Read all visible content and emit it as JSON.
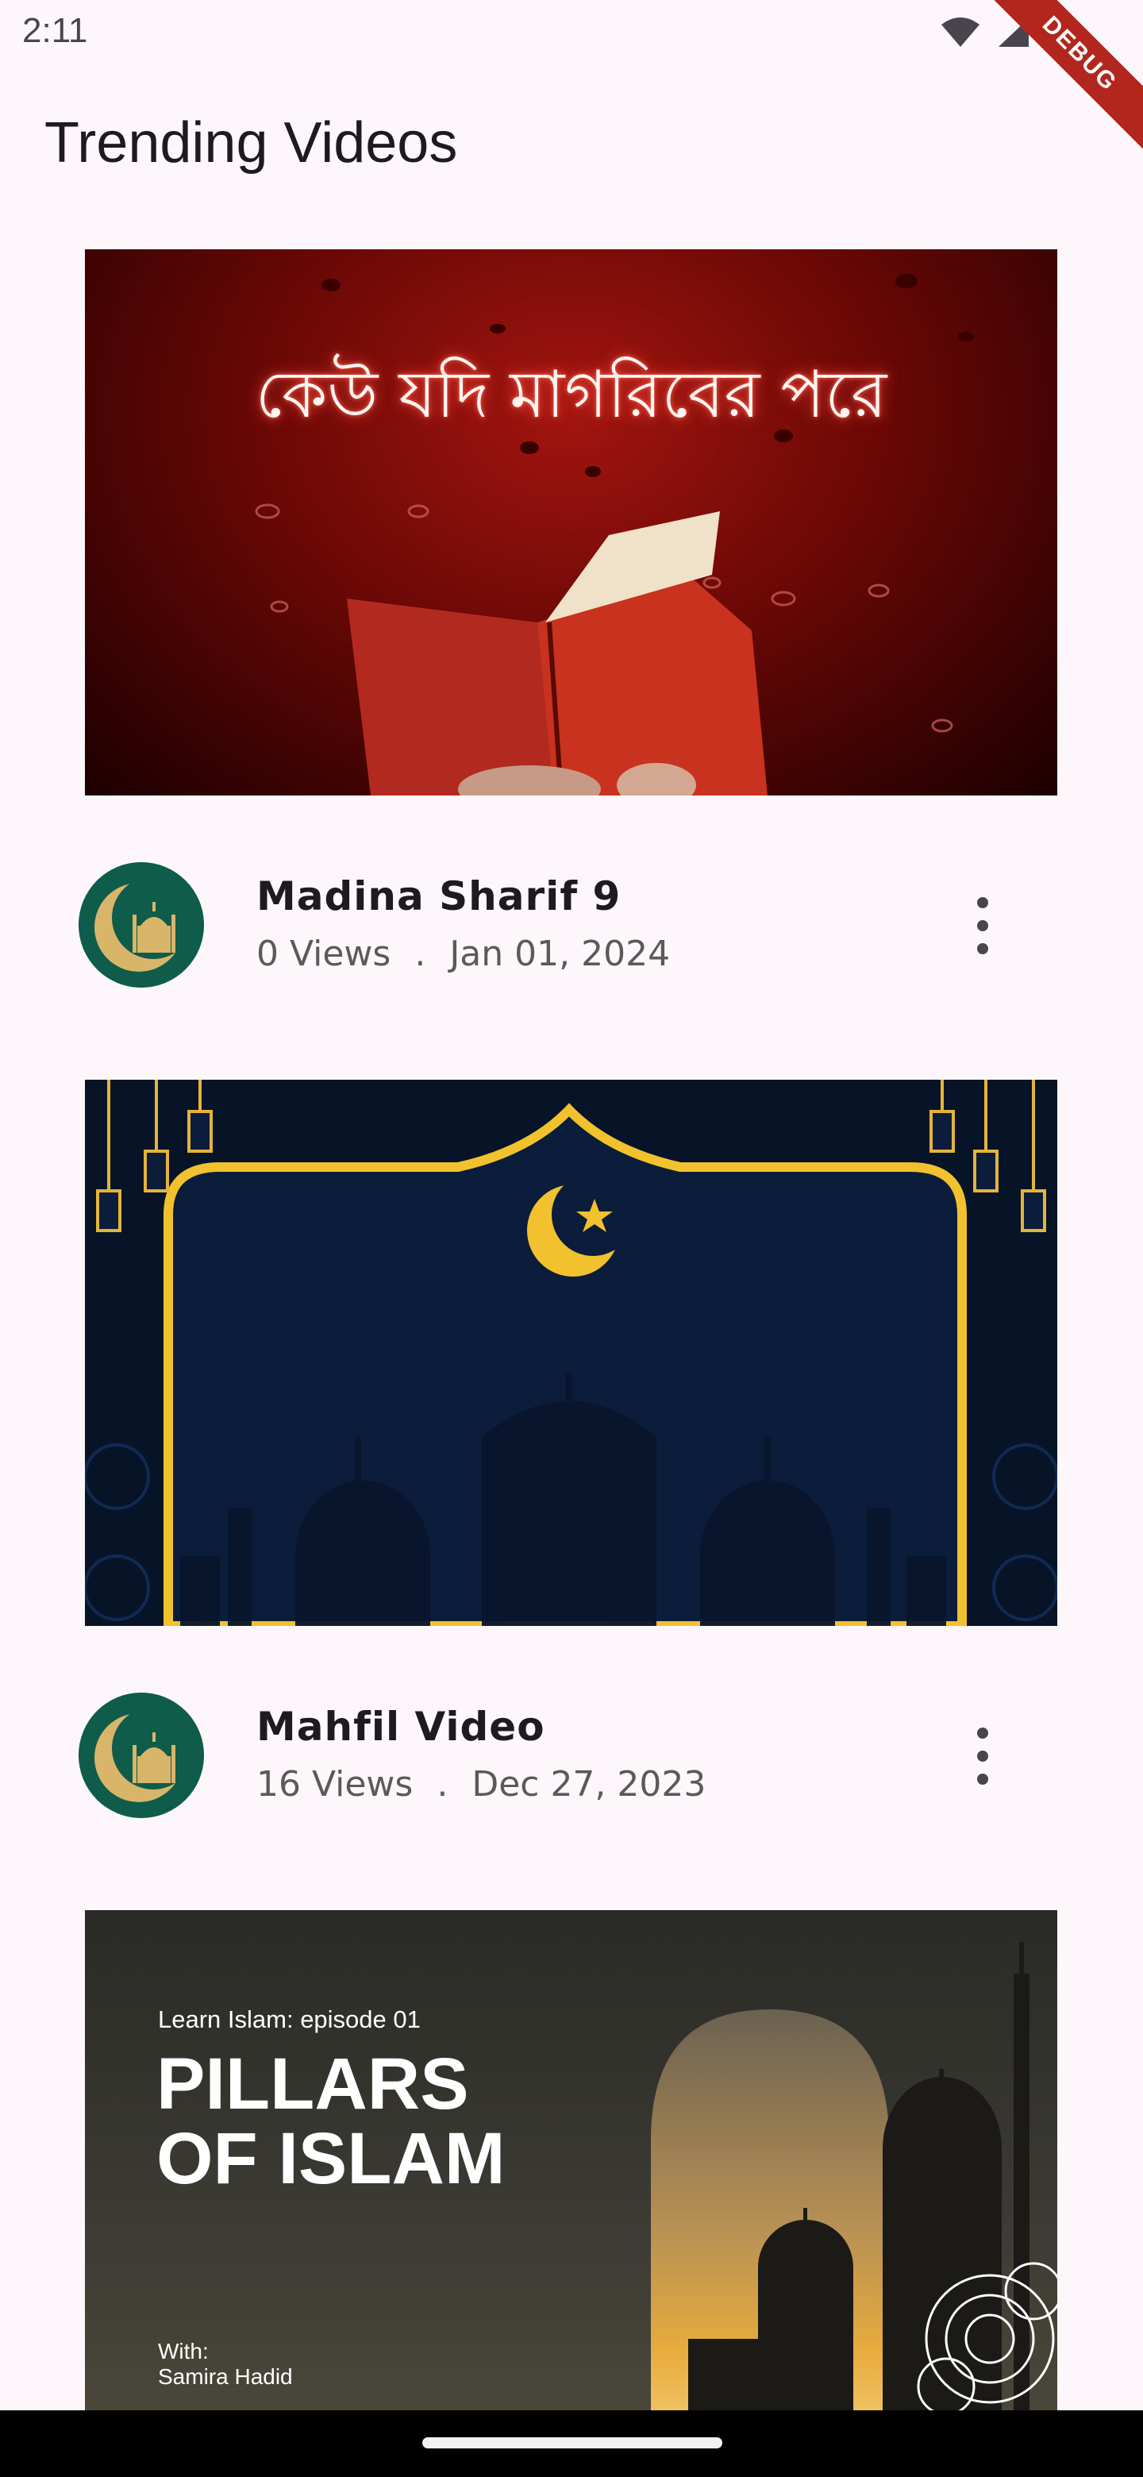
{
  "status_bar": {
    "time": "2:11",
    "debug_label": "DEBUG"
  },
  "app_bar": {
    "title": "Trending Videos"
  },
  "videos": [
    {
      "thumbnail_text": "কেউ যদি মাগরিবের পরে",
      "title": "Madina Sharif 9",
      "views": "0 Views",
      "separator": ".",
      "date": "Jan 01, 2024"
    },
    {
      "thumbnail_text": "",
      "title": "Mahfil Video",
      "views": "16 Views",
      "separator": ".",
      "date": "Dec 27, 2023"
    },
    {
      "thumbnail_kicker": "Learn Islam: episode 01",
      "thumbnail_headline_1": "PILLARS",
      "thumbnail_headline_2": "OF ISLAM",
      "thumbnail_with": "With:",
      "thumbnail_host": "Samira Hadid"
    }
  ],
  "colors": {
    "background": "#fdf7fb",
    "avatar_green": "#0f5c4a",
    "avatar_gold": "#d9b56a",
    "navy": "#0b1d3a",
    "gold": "#f2c12e"
  }
}
